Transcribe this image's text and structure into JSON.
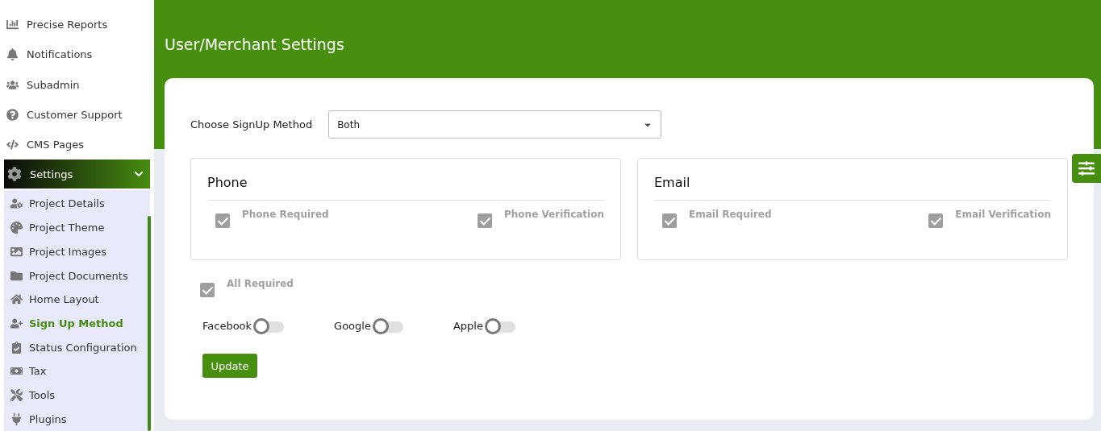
{
  "sidebar": {
    "items": [
      {
        "label": "Precise Reports",
        "selected": false
      },
      {
        "label": "Notifications",
        "selected": false
      },
      {
        "label": "Subadmin",
        "selected": false
      },
      {
        "label": "Customer Support",
        "selected": false
      },
      {
        "label": "CMS Pages",
        "selected": false
      },
      {
        "label": "Settings",
        "selected": true,
        "expanded": true,
        "children": [
          {
            "label": "Project Details",
            "selected": false
          },
          {
            "label": "Project Theme",
            "selected": false
          },
          {
            "label": "Project Images",
            "selected": false
          },
          {
            "label": "Project Documents",
            "selected": false
          },
          {
            "label": "Home Layout",
            "selected": false
          },
          {
            "label": "Sign Up Method",
            "selected": true
          },
          {
            "label": "Status Configuration",
            "selected": false
          },
          {
            "label": "Tax",
            "selected": false
          },
          {
            "label": "Tools",
            "selected": false
          },
          {
            "label": "Plugins",
            "selected": false
          }
        ]
      }
    ]
  },
  "page": {
    "title": "User/Merchant Settings"
  },
  "signup": {
    "label": "Choose SignUp Method",
    "value": "Both"
  },
  "groups": [
    {
      "title": "Phone",
      "options": [
        {
          "label": "Phone Required",
          "checked": true,
          "disabled": true
        },
        {
          "label": "Phone Verification",
          "checked": true,
          "disabled": true
        }
      ]
    },
    {
      "title": "Email",
      "options": [
        {
          "label": "Email Required",
          "checked": true,
          "disabled": true
        },
        {
          "label": "Email Verification",
          "checked": true,
          "disabled": true
        }
      ]
    }
  ],
  "all_required": {
    "label": "All Required",
    "checked": true,
    "disabled": true
  },
  "social": [
    {
      "label": "Facebook",
      "on": false
    },
    {
      "label": "Google",
      "on": false
    },
    {
      "label": "Apple",
      "on": false
    }
  ],
  "update_button": "Update"
}
